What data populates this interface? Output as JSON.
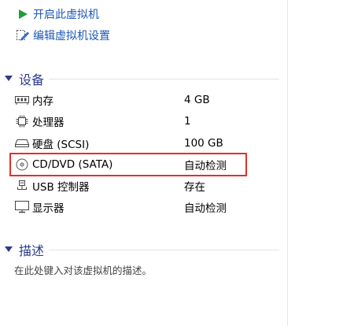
{
  "actions": {
    "power_on_label": "开启此虚拟机",
    "edit_settings_label": "编辑虚拟机设置"
  },
  "devices": {
    "title": "设备",
    "rows": [
      {
        "icon": "memory-icon",
        "name": "内存",
        "value": "4 GB"
      },
      {
        "icon": "processor-icon",
        "name": "处理器",
        "value": "1"
      },
      {
        "icon": "hard-disk-icon",
        "name": "硬盘 (SCSI)",
        "value": "100 GB"
      },
      {
        "icon": "cd-dvd-icon",
        "name": "CD/DVD (SATA)",
        "value": "自动检测"
      },
      {
        "icon": "usb-icon",
        "name": "USB 控制器",
        "value": "存在"
      },
      {
        "icon": "display-icon",
        "name": "显示器",
        "value": "自动检测"
      }
    ]
  },
  "description": {
    "title": "描述",
    "placeholder": "在此处键入对该虚拟机的描述。"
  },
  "colors": {
    "link": "#1b57b5",
    "section_title": "#2d3a8c",
    "play_green": "#1e9e3a",
    "highlight_border": "#e0302c"
  }
}
